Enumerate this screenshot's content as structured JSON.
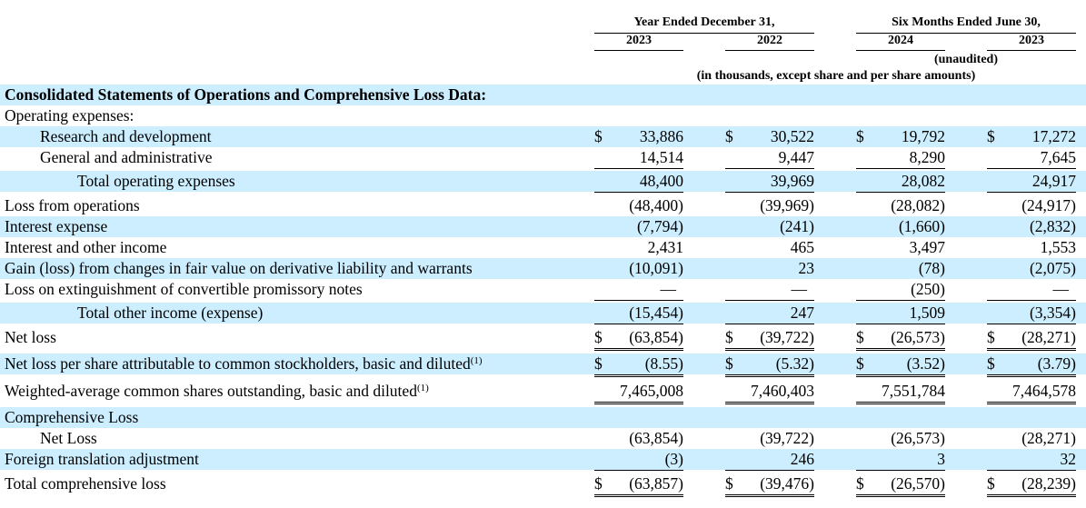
{
  "header": {
    "group1": "Year Ended December 31,",
    "group2": "Six Months Ended June 30,",
    "years": [
      "2023",
      "2022",
      "2024",
      "2023"
    ],
    "unaudited": "(unaudited)",
    "units_note": "(in thousands, except share and per share amounts)"
  },
  "section_title": "Consolidated Statements of Operations and Comprehensive Loss Data:",
  "rows": [
    {
      "label": "Operating expenses:",
      "values": [
        "",
        "",
        "",
        ""
      ]
    },
    {
      "label": "Research and development",
      "values": [
        "33,886",
        "30,522",
        "19,792",
        "17,272"
      ],
      "currency": "$"
    },
    {
      "label": "General and administrative",
      "values": [
        "14,514",
        "9,447",
        "8,290",
        "7,645"
      ]
    },
    {
      "label": "Total operating expenses",
      "values": [
        "48,400",
        "39,969",
        "28,082",
        "24,917"
      ]
    },
    {
      "label": "Loss from operations",
      "values": [
        "(48,400)",
        "(39,969)",
        "(28,082)",
        "(24,917)"
      ]
    },
    {
      "label": "Interest expense",
      "values": [
        "(7,794)",
        "(241)",
        "(1,660)",
        "(2,832)"
      ]
    },
    {
      "label": "Interest and other income",
      "values": [
        "2,431",
        "465",
        "3,497",
        "1,553"
      ]
    },
    {
      "label": "Gain (loss) from changes in fair value on derivative liability and warrants",
      "values": [
        "(10,091)",
        "23",
        "(78)",
        "(2,075)"
      ]
    },
    {
      "label": "Loss on extinguishment of convertible promissory notes",
      "values": [
        "—",
        "—",
        "(250)",
        "—"
      ]
    },
    {
      "label": "Total other income (expense)",
      "values": [
        "(15,454)",
        "247",
        "1,509",
        "(3,354)"
      ]
    },
    {
      "label": "Net loss",
      "values": [
        "(63,854)",
        "(39,722)",
        "(26,573)",
        "(28,271)"
      ],
      "currency": "$"
    },
    {
      "label": "Net loss per share attributable to common stockholders, basic and diluted",
      "footnote": "(1)",
      "values": [
        "(8.55)",
        "(5.32)",
        "(3.52)",
        "(3.79)"
      ],
      "currency": "$"
    },
    {
      "label": "Weighted-average common shares outstanding, basic and diluted",
      "footnote": "(1)",
      "values": [
        "7,465,008",
        "7,460,403",
        "7,551,784",
        "7,464,578"
      ]
    },
    {
      "label": "Comprehensive Loss",
      "values": [
        "",
        "",
        "",
        ""
      ]
    },
    {
      "label": "Net Loss",
      "values": [
        "(63,854)",
        "(39,722)",
        "(26,573)",
        "(28,271)"
      ]
    },
    {
      "label": "Foreign translation adjustment",
      "values": [
        "(3)",
        "246",
        "3",
        "32"
      ]
    },
    {
      "label": "Total comprehensive loss",
      "values": [
        "(63,857)",
        "(39,476)",
        "(26,570)",
        "(28,239)"
      ],
      "currency": "$"
    }
  ]
}
